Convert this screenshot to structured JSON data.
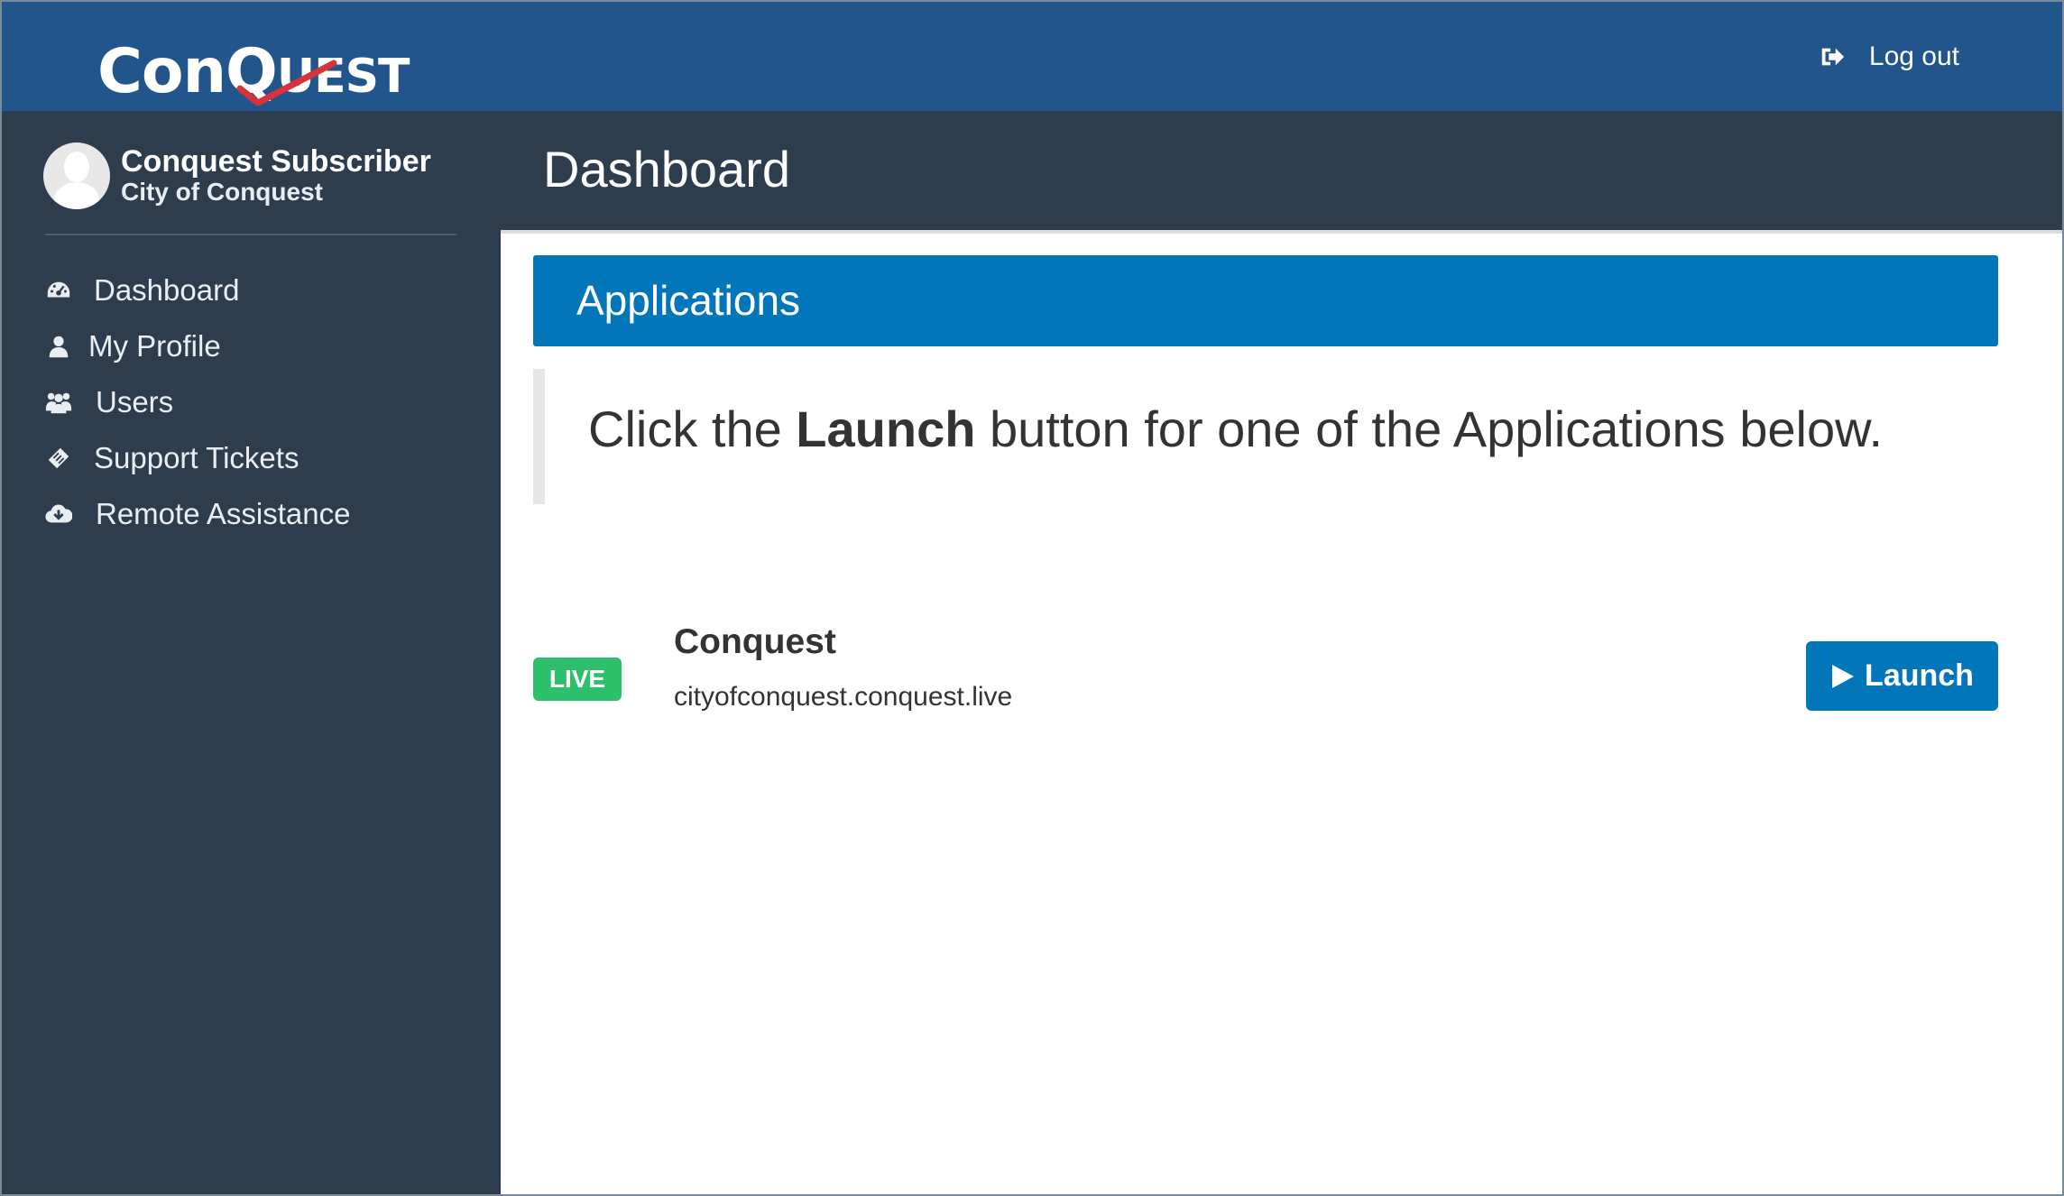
{
  "header": {
    "logo_text_main": "ConQ",
    "logo_text_small": "UEST",
    "logout_label": "Log out"
  },
  "user": {
    "name": "Conquest Subscriber",
    "organization": "City of Conquest"
  },
  "sidebar": {
    "items": [
      {
        "label": "Dashboard",
        "icon": "dashboard-icon"
      },
      {
        "label": "My Profile",
        "icon": "user-icon"
      },
      {
        "label": "Users",
        "icon": "users-icon"
      },
      {
        "label": "Support Tickets",
        "icon": "ticket-icon"
      },
      {
        "label": "Remote Assistance",
        "icon": "cloud-download-icon"
      }
    ]
  },
  "page": {
    "title": "Dashboard"
  },
  "main": {
    "section_title": "Applications",
    "instruction_before": "Click the ",
    "instruction_bold": "Launch",
    "instruction_after": " button for one of the Applications below.",
    "apps": [
      {
        "status": "LIVE",
        "name": "Conquest",
        "url": "cityofconquest.conquest.live",
        "launch_label": "Launch"
      }
    ]
  },
  "colors": {
    "topbar": "#22558c",
    "sidebar": "#2e3d4e",
    "accent": "#0276b9",
    "live": "#2dbf6b",
    "logo_check": "#d9323a"
  }
}
